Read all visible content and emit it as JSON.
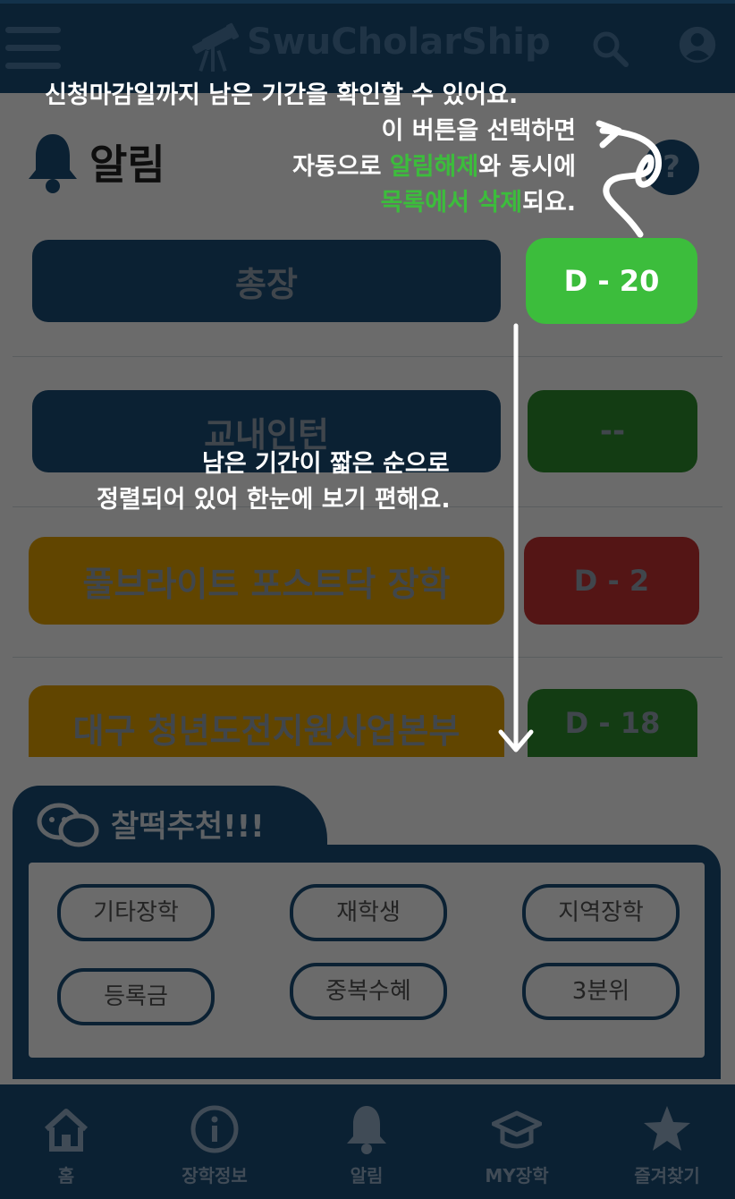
{
  "app": {
    "brand_name": "SwuCholarShip",
    "page_title": "알림",
    "help_symbol": "?"
  },
  "notifications": [
    {
      "title": "총장",
      "dday": "D - 20",
      "category_color": "#1b4f7a",
      "dday_color": "#3cbd3c"
    },
    {
      "title": "교내인턴",
      "dday": "--",
      "category_color": "#1b4f7a",
      "dday_color": "#2e8f2e"
    },
    {
      "title": "풀브라이트 포스트닥 장학",
      "dday": "D - 2",
      "category_color": "#e8a400",
      "dday_color": "#c83232"
    },
    {
      "title": "대구 청년도전지원사업본부",
      "dday": "D - 18",
      "category_color": "#e8a400",
      "dday_color": "#2e8f2e"
    }
  ],
  "recommend": {
    "title": "찰떡추천!!!",
    "tags": [
      "기타장학",
      "재학생",
      "지역장학",
      "등록금",
      "중복수혜",
      "3분위"
    ]
  },
  "bottom_nav": [
    {
      "label": "홈",
      "icon": "home-icon"
    },
    {
      "label": "장학정보",
      "icon": "info-icon"
    },
    {
      "label": "알림",
      "icon": "bell-icon"
    },
    {
      "label": "MY장학",
      "icon": "graduation-cap-icon"
    },
    {
      "label": "즐겨찾기",
      "icon": "star-icon"
    }
  ],
  "tutorial": {
    "top_line1": "신청마감일까지 남은 기간을  확인할 수 있어요.",
    "top_line2": "이 버튼을 선택하면",
    "top_line3_a": "자동으로 ",
    "top_line3_green": "알림해제",
    "top_line3_b": "와 동시에",
    "top_line4_green1": "목록에서",
    "top_line4_space": " ",
    "top_line4_green2": "삭제",
    "top_line4_b": "되요.",
    "middle_line1": "남은 기간이 짧은 순으로",
    "middle_line2": "정렬되어 있어 한눈에 보기 편해요.",
    "highlight_color": "#3cbd3c"
  }
}
